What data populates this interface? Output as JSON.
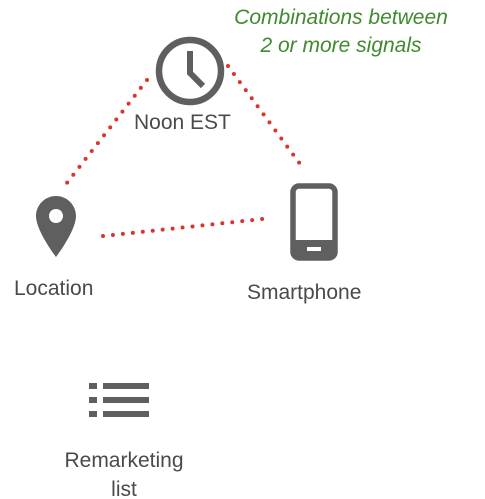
{
  "caption": {
    "line1": "Combinations between",
    "line2": "2 or more signals",
    "color": "#3f8a2e"
  },
  "nodes": {
    "clock": {
      "label": "Noon EST",
      "icon": "clock-icon"
    },
    "location": {
      "label": "Location",
      "icon": "location-pin-icon"
    },
    "smartphone": {
      "label": "Smartphone",
      "icon": "smartphone-icon"
    },
    "remarketing": {
      "label_line1": "Remarketing",
      "label_line2": "list",
      "icon": "list-icon"
    }
  },
  "style": {
    "icon_color": "#5f5f5f",
    "connector_color": "#d9362b"
  }
}
